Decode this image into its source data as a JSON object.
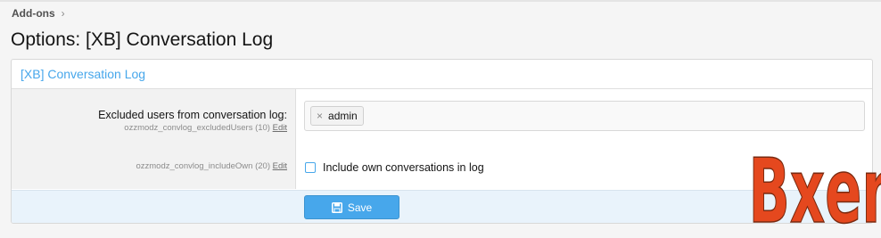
{
  "breadcrumb": {
    "items": [
      "Add-ons"
    ]
  },
  "page": {
    "title": "Options: [XB] Conversation Log"
  },
  "block": {
    "header": "[XB] Conversation Log",
    "rows": [
      {
        "label": "Excluded users from conversation log:",
        "option_id": "ozzmodz_convlog_excludedUsers (10)",
        "edit_label": "Edit",
        "tokens": [
          "admin"
        ]
      },
      {
        "option_id": "ozzmodz_convlog_includeOwn (20)",
        "edit_label": "Edit",
        "checkbox_label": "Include own conversations in log",
        "checked": false
      }
    ]
  },
  "footer": {
    "save_label": "Save"
  },
  "watermark": {
    "text": "Bxen"
  },
  "colors": {
    "accent": "#47a7eb",
    "footer_bg": "#e9f3fb",
    "watermark": "#e5481e"
  }
}
